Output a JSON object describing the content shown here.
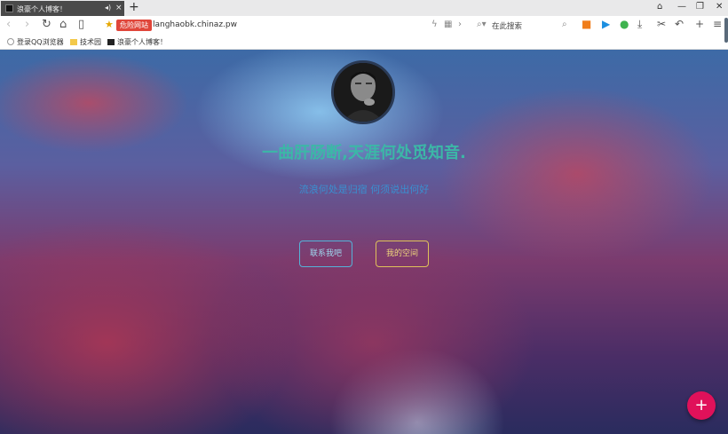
{
  "browser": {
    "tab_title": "浪豪个人博客！",
    "new_tab_label": "+",
    "danger_badge": "危险网站",
    "url": "langhaobk.chinaz.pw",
    "search_placeholder": "在此搜索",
    "bookmarks": [
      {
        "label": "登录QQ浏览器"
      },
      {
        "label": "技术园"
      },
      {
        "label": "浪豪个人博客！"
      }
    ]
  },
  "page": {
    "headline": "一曲肝肠断,天涯何处觅知音.",
    "subtitle": "流浪何处是归宿 何须说出何好",
    "buttons": {
      "contact": "联系我吧",
      "space": "我的空间"
    },
    "fab_label": "+"
  },
  "colors": {
    "headline": "#3cb7a7",
    "subtitle": "#3a8fd0",
    "contact_border": "#55b2d8",
    "space_border": "#e0c15a",
    "fab": "#e0115a",
    "danger_badge": "#e0463a"
  }
}
